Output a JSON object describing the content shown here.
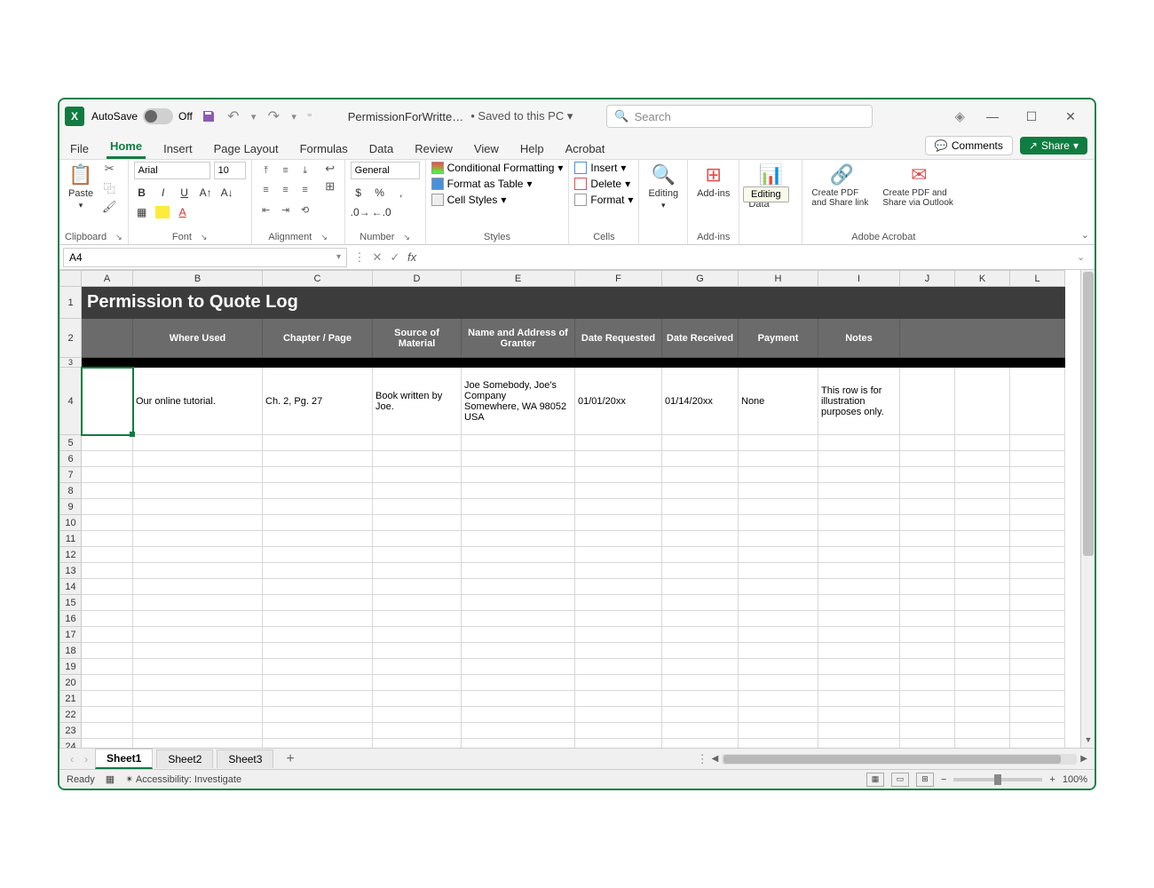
{
  "titlebar": {
    "autosave_label": "AutoSave",
    "autosave_state": "Off",
    "doc_name": "PermissionForWritte…",
    "saved_status": "Saved to this PC",
    "search_placeholder": "Search"
  },
  "tabs": {
    "items": [
      "File",
      "Home",
      "Insert",
      "Page Layout",
      "Formulas",
      "Data",
      "Review",
      "View",
      "Help",
      "Acrobat"
    ],
    "active": "Home",
    "comments": "Comments",
    "share": "Share"
  },
  "ribbon": {
    "clipboard": {
      "paste": "Paste",
      "label": "Clipboard"
    },
    "font": {
      "name": "Arial",
      "size": "10",
      "label": "Font"
    },
    "alignment": {
      "label": "Alignment"
    },
    "number": {
      "format": "General",
      "label": "Number"
    },
    "styles": {
      "cond": "Conditional Formatting",
      "table": "Format as Table",
      "cell": "Cell Styles",
      "label": "Styles"
    },
    "cells": {
      "insert": "Insert",
      "delete": "Delete",
      "format": "Format",
      "label": "Cells"
    },
    "editing": {
      "label": "Editing",
      "tooltip": "Editing"
    },
    "addins": {
      "btn": "Add-ins",
      "label": "Add-ins"
    },
    "analyze": {
      "btn": "Analyze Data"
    },
    "acrobat": {
      "pdf1": "Create PDF and Share link",
      "pdf2": "Create PDF and Share via Outlook",
      "label": "Adobe Acrobat"
    }
  },
  "formulabar": {
    "cell_ref": "A4"
  },
  "columns": [
    "A",
    "B",
    "C",
    "D",
    "E",
    "F",
    "G",
    "H",
    "I",
    "J",
    "K",
    "L"
  ],
  "sheet": {
    "title": "Permission to Quote Log",
    "headers": [
      "",
      "Where Used",
      "Chapter / Page",
      "Source of Material",
      "Name and Address of Granter",
      "Date Requested",
      "Date Received",
      "Payment",
      "Notes"
    ],
    "row4": {
      "b": "Our online tutorial.",
      "c": "Ch. 2, Pg. 27",
      "d": "Book written by Joe.",
      "e": "Joe Somebody, Joe's Company\nSomewhere, WA 98052\nUSA",
      "f": "01/01/20xx",
      "g": "01/14/20xx",
      "h": "None",
      "i": "This row is for illustration purposes only."
    }
  },
  "sheet_tabs": [
    "Sheet1",
    "Sheet2",
    "Sheet3"
  ],
  "statusbar": {
    "ready": "Ready",
    "accessibility": "Accessibility: Investigate",
    "zoom": "100%"
  }
}
